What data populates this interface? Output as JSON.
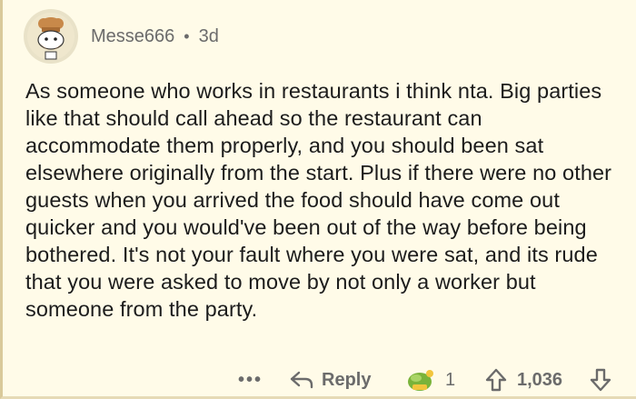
{
  "comment": {
    "username": "Messe666",
    "separator": "•",
    "age": "3d",
    "text": "As someone who works in restaurants i think nta. Big parties like that should call ahead so the restaurant can accommodate them properly, and you should been sat elsewhere originally from the start. Plus if there were no other guests when you arrived the food should have come out quicker and you would've been out of the way before being bothered. It's not your fault where you were sat, and its rude that you were asked to move by not only a worker but someone from the party."
  },
  "footer": {
    "more": "•••",
    "reply_label": "Reply",
    "award_count": "1",
    "vote_count": "1,036"
  },
  "icons": {
    "avatar": "snoo-chef-avatar",
    "reply": "reply-arrow-icon",
    "award": "award-icon",
    "upvote": "upvote-arrow-icon",
    "downvote": "downvote-arrow-icon"
  },
  "colors": {
    "background": "#fffbe8",
    "text": "#1c1c1c",
    "muted": "#6b6b6b"
  }
}
